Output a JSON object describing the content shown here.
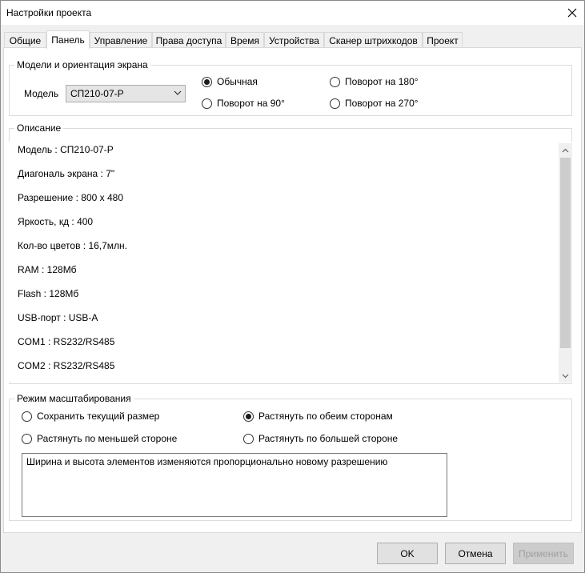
{
  "window": {
    "title": "Настройки проекта"
  },
  "tabs": {
    "items": [
      "Общие",
      "Панель",
      "Управление",
      "Права доступа",
      "Время",
      "Устройства",
      "Сканер штрихкодов",
      "Проект"
    ],
    "active": 1
  },
  "screen_group": {
    "title": "Модели и ориентация экрана",
    "model_label": "Модель",
    "model_value": "СП210-07-Р",
    "orientation_options": [
      "Обычная",
      "Поворот на 180°",
      "Поворот на 90°",
      "Поворот на 270°"
    ],
    "selected": 0
  },
  "description": {
    "title": "Описание",
    "lines": [
      "Модель : СП210-07-Р",
      "Диагональ экрана : 7\"",
      "Разрешение : 800 x 480",
      "Яркость, кд : 400",
      "Кол-во цветов : 16,7млн.",
      "RAM : 128Мб",
      "Flash : 128Мб",
      "USB-порт : USB-A",
      "COM1 : RS232/RS485",
      "COM2 : RS232/RS485"
    ]
  },
  "scale_group": {
    "title": "Режим масштабирования",
    "options": [
      "Сохранить текущий размер",
      "Растянуть по обеим сторонам",
      "Растянуть по меньшей стороне",
      "Растянуть по большей стороне"
    ],
    "selected": 1,
    "hint": "Ширина и высота элементов изменяются пропорционально новому разрешению"
  },
  "buttons": {
    "ok": "OK",
    "cancel": "Отмена",
    "apply": "Применить"
  }
}
